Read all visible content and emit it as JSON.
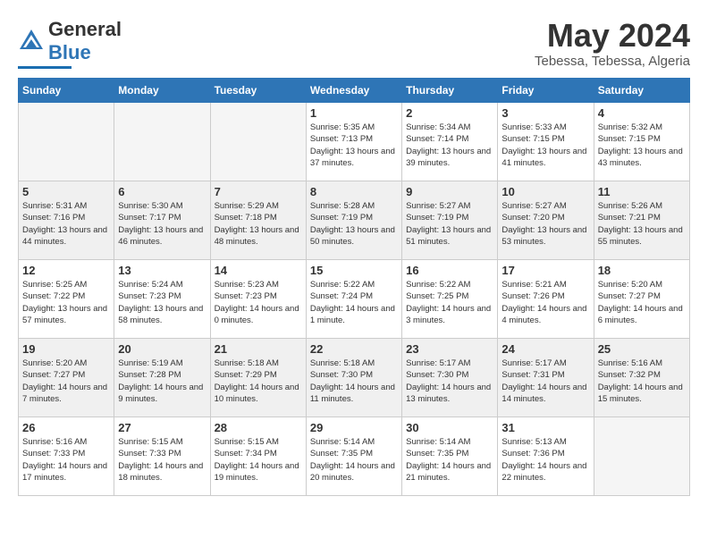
{
  "header": {
    "logo_general": "General",
    "logo_blue": "Blue",
    "title": "May 2024",
    "location": "Tebessa, Tebessa, Algeria"
  },
  "weekdays": [
    "Sunday",
    "Monday",
    "Tuesday",
    "Wednesday",
    "Thursday",
    "Friday",
    "Saturday"
  ],
  "weeks": [
    [
      {
        "day": "",
        "empty": true
      },
      {
        "day": "",
        "empty": true
      },
      {
        "day": "",
        "empty": true
      },
      {
        "day": "1",
        "sunrise": "5:35 AM",
        "sunset": "7:13 PM",
        "daylight": "13 hours and 37 minutes."
      },
      {
        "day": "2",
        "sunrise": "5:34 AM",
        "sunset": "7:14 PM",
        "daylight": "13 hours and 39 minutes."
      },
      {
        "day": "3",
        "sunrise": "5:33 AM",
        "sunset": "7:15 PM",
        "daylight": "13 hours and 41 minutes."
      },
      {
        "day": "4",
        "sunrise": "5:32 AM",
        "sunset": "7:15 PM",
        "daylight": "13 hours and 43 minutes."
      }
    ],
    [
      {
        "day": "5",
        "sunrise": "5:31 AM",
        "sunset": "7:16 PM",
        "daylight": "13 hours and 44 minutes."
      },
      {
        "day": "6",
        "sunrise": "5:30 AM",
        "sunset": "7:17 PM",
        "daylight": "13 hours and 46 minutes."
      },
      {
        "day": "7",
        "sunrise": "5:29 AM",
        "sunset": "7:18 PM",
        "daylight": "13 hours and 48 minutes."
      },
      {
        "day": "8",
        "sunrise": "5:28 AM",
        "sunset": "7:19 PM",
        "daylight": "13 hours and 50 minutes."
      },
      {
        "day": "9",
        "sunrise": "5:27 AM",
        "sunset": "7:19 PM",
        "daylight": "13 hours and 51 minutes."
      },
      {
        "day": "10",
        "sunrise": "5:27 AM",
        "sunset": "7:20 PM",
        "daylight": "13 hours and 53 minutes."
      },
      {
        "day": "11",
        "sunrise": "5:26 AM",
        "sunset": "7:21 PM",
        "daylight": "13 hours and 55 minutes."
      }
    ],
    [
      {
        "day": "12",
        "sunrise": "5:25 AM",
        "sunset": "7:22 PM",
        "daylight": "13 hours and 57 minutes."
      },
      {
        "day": "13",
        "sunrise": "5:24 AM",
        "sunset": "7:23 PM",
        "daylight": "13 hours and 58 minutes."
      },
      {
        "day": "14",
        "sunrise": "5:23 AM",
        "sunset": "7:23 PM",
        "daylight": "14 hours and 0 minutes."
      },
      {
        "day": "15",
        "sunrise": "5:22 AM",
        "sunset": "7:24 PM",
        "daylight": "14 hours and 1 minute."
      },
      {
        "day": "16",
        "sunrise": "5:22 AM",
        "sunset": "7:25 PM",
        "daylight": "14 hours and 3 minutes."
      },
      {
        "day": "17",
        "sunrise": "5:21 AM",
        "sunset": "7:26 PM",
        "daylight": "14 hours and 4 minutes."
      },
      {
        "day": "18",
        "sunrise": "5:20 AM",
        "sunset": "7:27 PM",
        "daylight": "14 hours and 6 minutes."
      }
    ],
    [
      {
        "day": "19",
        "sunrise": "5:20 AM",
        "sunset": "7:27 PM",
        "daylight": "14 hours and 7 minutes."
      },
      {
        "day": "20",
        "sunrise": "5:19 AM",
        "sunset": "7:28 PM",
        "daylight": "14 hours and 9 minutes."
      },
      {
        "day": "21",
        "sunrise": "5:18 AM",
        "sunset": "7:29 PM",
        "daylight": "14 hours and 10 minutes."
      },
      {
        "day": "22",
        "sunrise": "5:18 AM",
        "sunset": "7:30 PM",
        "daylight": "14 hours and 11 minutes."
      },
      {
        "day": "23",
        "sunrise": "5:17 AM",
        "sunset": "7:30 PM",
        "daylight": "14 hours and 13 minutes."
      },
      {
        "day": "24",
        "sunrise": "5:17 AM",
        "sunset": "7:31 PM",
        "daylight": "14 hours and 14 minutes."
      },
      {
        "day": "25",
        "sunrise": "5:16 AM",
        "sunset": "7:32 PM",
        "daylight": "14 hours and 15 minutes."
      }
    ],
    [
      {
        "day": "26",
        "sunrise": "5:16 AM",
        "sunset": "7:33 PM",
        "daylight": "14 hours and 17 minutes."
      },
      {
        "day": "27",
        "sunrise": "5:15 AM",
        "sunset": "7:33 PM",
        "daylight": "14 hours and 18 minutes."
      },
      {
        "day": "28",
        "sunrise": "5:15 AM",
        "sunset": "7:34 PM",
        "daylight": "14 hours and 19 minutes."
      },
      {
        "day": "29",
        "sunrise": "5:14 AM",
        "sunset": "7:35 PM",
        "daylight": "14 hours and 20 minutes."
      },
      {
        "day": "30",
        "sunrise": "5:14 AM",
        "sunset": "7:35 PM",
        "daylight": "14 hours and 21 minutes."
      },
      {
        "day": "31",
        "sunrise": "5:13 AM",
        "sunset": "7:36 PM",
        "daylight": "14 hours and 22 minutes."
      },
      {
        "day": "",
        "empty": true
      }
    ]
  ]
}
